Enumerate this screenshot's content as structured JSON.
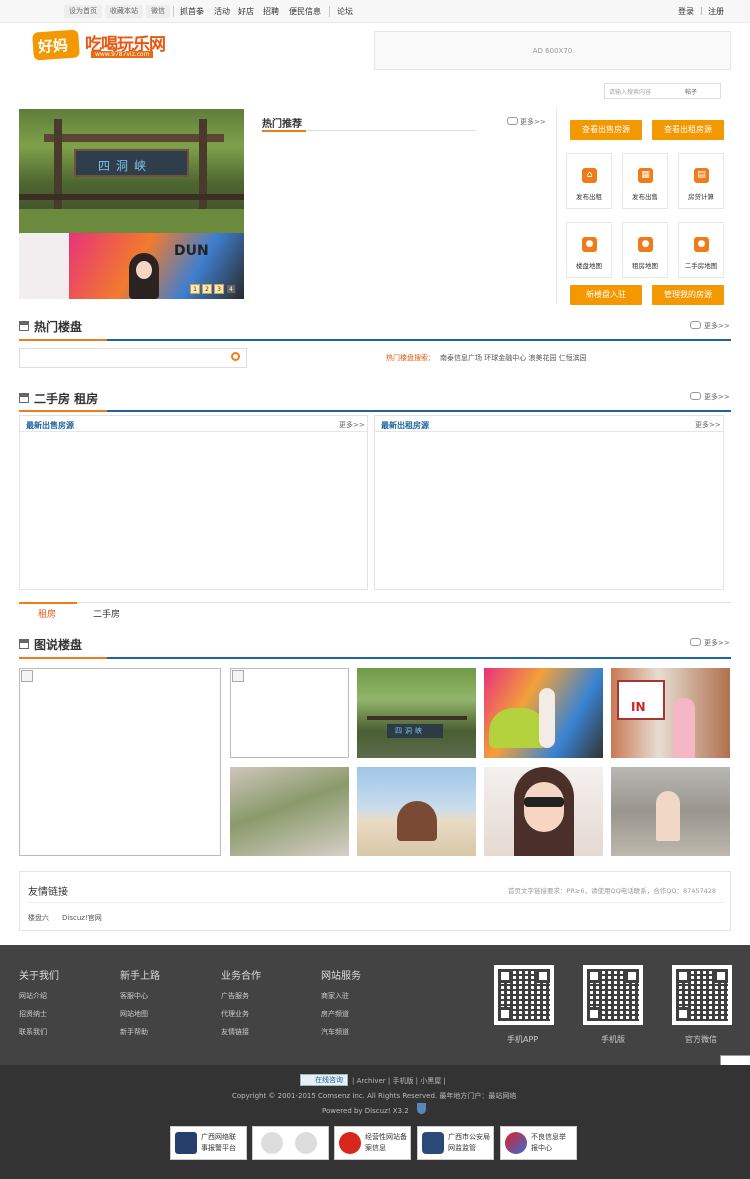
{
  "topbar": {
    "set_home": "设为首页",
    "favorite": "收藏本站",
    "weixin": "微信",
    "nav": [
      "抓首拳",
      "活动",
      "好店",
      "招聘",
      "便民信息",
      "论坛"
    ],
    "login": "登录",
    "register": "注册"
  },
  "header": {
    "logo_badge": "好妈",
    "logo_text": "吃喝玩乐网",
    "logo_url": "www.9787viz.com",
    "ad_text": "AD 600X70",
    "search_placeholder": "请输入搜索内容",
    "search_scope": "帖子"
  },
  "slider": {
    "sign_text": "四洞峡",
    "pages": [
      "1",
      "2",
      "3",
      "4"
    ]
  },
  "hot_recommend": {
    "title": "热门推荐",
    "more": "更多>>"
  },
  "house_tools": {
    "btn_sale": "查看出售房源",
    "btn_rent": "查看出租房源",
    "tiles": [
      {
        "label": "发布出租",
        "icon": "house-icon"
      },
      {
        "label": "发布出售",
        "icon": "building-icon"
      },
      {
        "label": "房贷计算",
        "icon": "calculator-icon"
      },
      {
        "label": "楼盘地图",
        "icon": "map-pin-icon"
      },
      {
        "label": "租房地图",
        "icon": "map-pin-icon"
      },
      {
        "label": "二手房地图",
        "icon": "map-pin-icon"
      }
    ],
    "btn_new": "新楼盘入驻",
    "btn_manage": "管理我的房源"
  },
  "hot_estates": {
    "title": "热门楼盘",
    "more": "更多>>",
    "hot_search_label": "热门楼盘搜索：",
    "hot_search_items": "南泰信息广场 环球金融中心 浪美花园 仁恒滨园"
  },
  "secondhand_rent": {
    "title": "二手房 租房",
    "more": "更多>>",
    "left_title": "最新出售房源",
    "left_more": "更多>>",
    "right_title": "最新出租房源",
    "right_more": "更多>>"
  },
  "tabs": {
    "rent": "租房",
    "secondhand": "二手房"
  },
  "picture_estates": {
    "title": "图说楼盘",
    "more": "更多>>",
    "sign_text": "四洞峡",
    "in_text": "IN"
  },
  "links": {
    "title": "友情链接",
    "notice": "首页文字链接要求：PR≥6，请使用QQ电话联系，合作QQ：87457428",
    "items": [
      "楼盘六",
      "Discuz!官网"
    ]
  },
  "footer": {
    "cols": [
      {
        "title": "关于我们",
        "items": [
          "网站介绍",
          "招贤纳士",
          "联系我们"
        ]
      },
      {
        "title": "新手上路",
        "items": [
          "客服中心",
          "网站地图",
          "新手帮助"
        ]
      },
      {
        "title": "业务合作",
        "items": [
          "广告服务",
          "代理业务",
          "友情链接"
        ]
      },
      {
        "title": "网站服务",
        "items": [
          "商家入驻",
          "房产频道",
          "汽车频道"
        ]
      }
    ],
    "qrs": [
      "手机APP",
      "手机版",
      "官方微信"
    ],
    "online_service": "在线咨询",
    "archive_line": "| Archiver | 手机版 | 小黑屋 |",
    "copyright": "Copyright © 2001-2015 Comsenz Inc. All Rights Reserved.   最年地方门户：最站网络",
    "powered": "Powered by Discuz! X3.2",
    "badges": [
      {
        "text": "广西网络联\n事报警平台"
      },
      {
        "text": ""
      },
      {
        "text": "经营性网站备\n案信息"
      },
      {
        "text": "广西市公安局\n网监监管"
      },
      {
        "text": "不良信息举\n报中心"
      }
    ]
  },
  "colors": {
    "orange": "#f39800",
    "blue_line": "#1d64a0",
    "footer_bg": "#434343"
  }
}
